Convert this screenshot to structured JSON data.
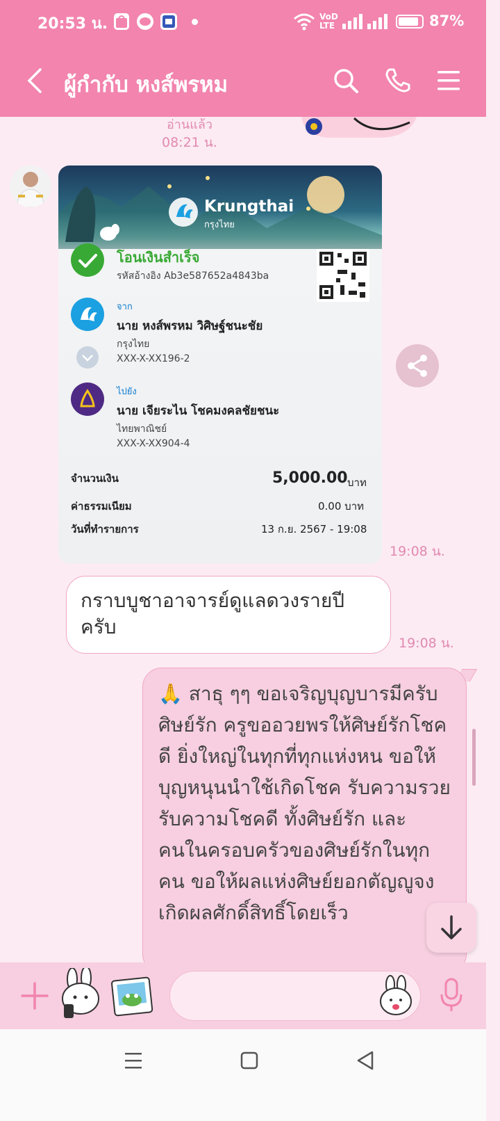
{
  "status_bar": {
    "time": "20:53 น.",
    "network_label_top": "VoD",
    "network_label_bottom": "LTE",
    "battery_percent_text": "87%",
    "battery_level": 0.87
  },
  "header": {
    "title": "ผู้กำกับ หงส์พรหม",
    "icons": [
      "back-icon",
      "search-icon",
      "phone-icon",
      "menu-icon"
    ]
  },
  "chat": {
    "read_label": "อ่านแล้ว",
    "read_time": "08:21 น.",
    "slip": {
      "brand": "Krungthai",
      "brand_sub": "กรุงไทย",
      "status": "โอนเงินสำเร็จ",
      "reference": "รหัสอ้างอิง Ab3e587652a4843ba",
      "from_label": "จาก",
      "from_name": "นาย หงส์พรหม วิศิษฐ์ชนะชัย",
      "from_bank": "กรุงไทย",
      "from_account": "XXX-X-XX196-2",
      "to_label": "ไปยัง",
      "to_name": "นาย เจียระไน โชคมงคลชัยชนะ",
      "to_bank": "ไทยพาณิชย์",
      "to_account": "XXX-X-XX904-4",
      "amount_label": "จำนวนเงิน",
      "amount": "5,000.00",
      "currency": "บาท",
      "fee_label": "ค่าธรรมเนียม",
      "fee": "0.00 บาท",
      "date_label": "วันที่ทำรายการ",
      "date": "13 ก.ย. 2567 - 19:08",
      "colors": {
        "success": "#39a935",
        "krungthai": "#1ba0e1",
        "scb": "#4e2a84"
      }
    },
    "slip_time": "19:08 น.",
    "incoming_message": "กราบบูชาอาจารย์ดูแลดวงรายปีครับ",
    "incoming_time": "19:08 น.",
    "outgoing_message": "🙏 สาธุ ๆๆ ขอเจริญบุญบารมีครับศิษย์รัก ครูขออวยพรให้ศิษย์รักโชคดี ยิ่งใหญ่ในทุกที่ทุกแห่งหน ขอให้บุญหนุนนำใช้เกิดโชค รับความรวย รับความโชคดี ทั้งศิษย์รัก และคนในครอบครัวของศิษย์รักในทุกคน ขอให้ผลแห่งศิษย์ยอกตัญญูจงเกิดผลศักดิ์สิทธิ์โดยเร็ว"
  },
  "input_bar": {
    "placeholder": "",
    "icons": [
      "plus-icon",
      "sticker-icon",
      "photo-icon",
      "emoji-icon",
      "mic-icon"
    ]
  },
  "nav_bar": {
    "icons": [
      "recent-apps-icon",
      "home-icon",
      "back-nav-icon"
    ]
  },
  "colors": {
    "header": "#f284ae",
    "chat_bg": "#fcebf3",
    "accent_text": "#e28ab0"
  }
}
